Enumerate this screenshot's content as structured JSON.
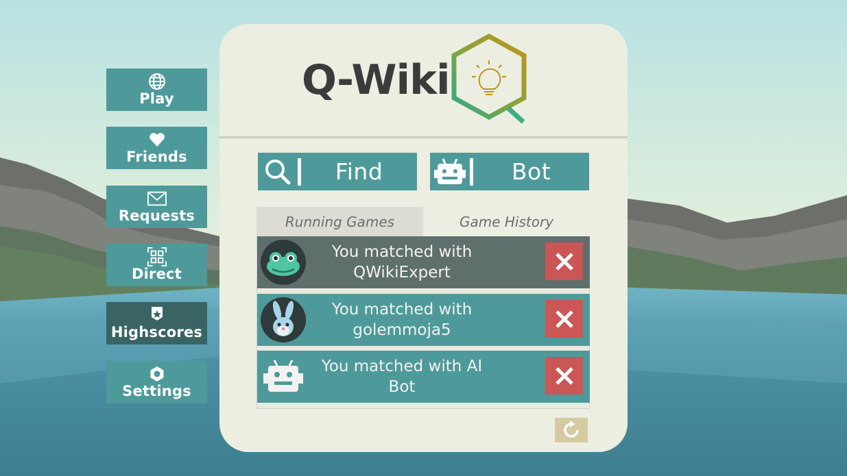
{
  "side_menu": {
    "items": [
      {
        "label": "Play",
        "icon": "globe-icon"
      },
      {
        "label": "Friends",
        "icon": "heart-icon"
      },
      {
        "label": "Requests",
        "icon": "envelope-icon"
      },
      {
        "label": "Direct",
        "icon": "qr-code-icon"
      },
      {
        "label": "Highscores",
        "icon": "trophy-icon",
        "selected": true
      },
      {
        "label": "Settings",
        "icon": "gear-icon"
      }
    ]
  },
  "logo": {
    "title": "Q-Wiki",
    "icon": "hexagon-lightbulb-icon"
  },
  "actions": {
    "find_label": "Find",
    "find_icon": "search-icon",
    "bot_label": "Bot",
    "bot_icon": "robot-icon"
  },
  "tabs": {
    "running": "Running Games",
    "history": "Game History",
    "active": "Running Games"
  },
  "games": [
    {
      "text": "You matched with QWikiExpert",
      "line1": "You matched with",
      "line2": "QWikiExpert",
      "avatar": "frog-avatar",
      "selected": true
    },
    {
      "text": "You matched with golemmoja5",
      "line1": "You matched with",
      "line2": "golemmoja5",
      "avatar": "rabbit-avatar",
      "selected": false
    },
    {
      "text": "You matched with AI Bot",
      "line1": "You matched with AI",
      "line2": "Bot",
      "avatar": "robot-avatar",
      "selected": false
    }
  ],
  "colors": {
    "teal": "#4e9a9a",
    "teal_dark": "#3a6363",
    "panel": "#eceee2",
    "delete_red": "#cb5656",
    "refresh": "#d6caa2"
  }
}
